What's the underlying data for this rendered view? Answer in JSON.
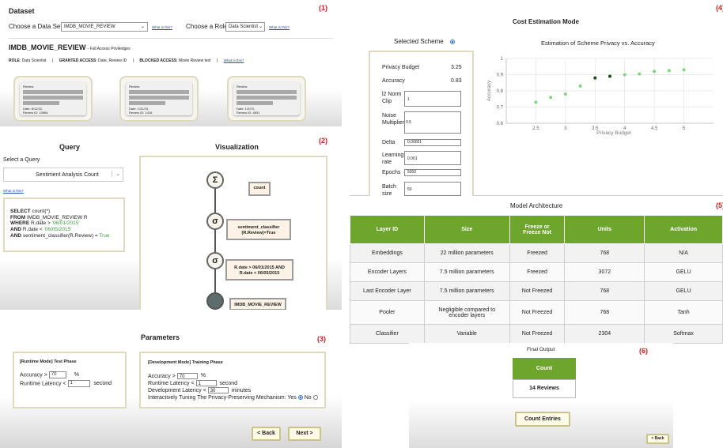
{
  "p1": {
    "tag": "(1)",
    "title": "Dataset",
    "choose_dataset": "Choose a Data Set",
    "dataset": "IMDB_MOVIE_REVIEW",
    "what1": "What is this?",
    "choose_role": "Choose a Role",
    "role": "Data Scientist",
    "what2": "What is this?",
    "dataset_name": "IMDB_MOVIE_REVIEW",
    "privileges": "- Full Access Priviledges",
    "role_label": "ROLE",
    "role_value": ": Data Scientist",
    "granted_label": "GRANTED ACCESS",
    "granted_value": ": Date, Review ID",
    "blocked_label": "BLOCKED ACCESS",
    "blocked_value": ": Movie Review text",
    "what3": "What is this?",
    "cards": [
      {
        "title": "Review:",
        "date": "Date: 8/12/22,",
        "rid": "Review ID: 10984"
      },
      {
        "title": "Review:",
        "date": "Date: 1/31/23,",
        "rid": "Review ID: 1416"
      },
      {
        "title": "Review:",
        "date": "Date: 1/2/23,",
        "rid": "Review ID: 4831"
      }
    ]
  },
  "p2": {
    "tag": "(2)",
    "query_title": "Query",
    "viz_title": "Visualization",
    "select_query": "Select a Query",
    "query": "Sentiment Analysis Count",
    "what": "What is this?",
    "sql": [
      {
        "k": "SELECT",
        "v": " count(*)"
      },
      {
        "k": "FROM",
        "v": " IMDB_MOVIE_REVIEW R"
      },
      {
        "k": "WHERE",
        "v": " R.date > ",
        "s": "'06/01/2015'"
      },
      {
        "k": "AND",
        "v": " R.date < ",
        "s": "'06/05/2015'"
      },
      {
        "k": "AND",
        "v": " sentiment_classifier(R.Review) = ",
        "s": "True"
      }
    ],
    "nodes": {
      "sigma": "Σ",
      "s1": "σ",
      "s2": "σ"
    },
    "count_box": "count",
    "classifier_box_1": "sentiment_classifier",
    "classifier_box_2": "(R.Review)=True",
    "date_box_1": "R.date > 06/01/2015 AND",
    "date_box_2": "R.date < 06/05/2015",
    "table_box": "IMDB_MOVIE_REVIEW"
  },
  "p3": {
    "tag": "(3)",
    "title": "Parameters",
    "runtime_title": "[Runtime Mode] Test Phase",
    "acc_label": "Accuracy  >",
    "acc_val": "70",
    "pct": "%",
    "rt_label": "Runtime Latency  <",
    "rt_val": "1",
    "second": "second",
    "dev_title": "[Development Mode] Training Phase",
    "dacc_label": "Accuracy  >",
    "dacc_val": "70",
    "dpct": "%",
    "drt_label": "Runtime Latency  <",
    "drt_val": "1",
    "dsecond": "second",
    "dev_label": "Development Latency  <",
    "dev_val": "30",
    "minutes": "minutes",
    "tune_label": "Interactively Tuning The Privacy-Preserving Mechanism:",
    "yes": "Yes",
    "no": "No",
    "back": "< Back",
    "next": "Next >"
  },
  "p4": {
    "tag": "(4)",
    "title": "Cost Estimation Mode",
    "selected_scheme": "Selected Scheme",
    "fields": {
      "budget_label": "Privacy Budget",
      "budget_val": "3.25",
      "acc_label": "Accuracy",
      "acc_val": "0.83",
      "l2_label_1": "l2 Norm",
      "l2_label_2": "Clip",
      "l2_val": "1",
      "noise_label_1": "Noise",
      "noise_label_2": "Multiplier",
      "noise_val": "0.5",
      "delta_label": "Delta",
      "delta_val": "0.00001",
      "lr_label_1": "Learning",
      "lr_label_2": "rate",
      "lr_val": "0.001",
      "epochs_label": "Epochs",
      "epochs_val": "5000",
      "batch_label_1": "Batch",
      "batch_label_2": "size",
      "batch_val": "50"
    }
  },
  "chart_data": {
    "type": "scatter",
    "title": "Estimation of Scheme Privacy vs. Accuracy",
    "xlabel": "Privacy Budget",
    "ylabel": "Accuracy",
    "xlim": [
      2,
      5.5
    ],
    "ylim": [
      0.6,
      1.0
    ],
    "xticks": [
      "2.5",
      "3",
      "3.5",
      "4",
      "4.5",
      "5"
    ],
    "yticks": [
      "0.6",
      "0.7",
      "0.8",
      "0.9",
      "1"
    ],
    "grid": true,
    "x": [
      2.5,
      2.75,
      3.0,
      3.25,
      3.5,
      3.75,
      4.0,
      4.25,
      4.5,
      4.75,
      5.0
    ],
    "y": [
      0.73,
      0.76,
      0.78,
      0.83,
      0.88,
      0.89,
      0.9,
      0.905,
      0.92,
      0.925,
      0.93
    ],
    "highlight": [
      3.5,
      3.75
    ],
    "point_color": "#7fd67f",
    "highlight_color": "#1c4a1c"
  },
  "p5": {
    "tag": "(5)",
    "title": "Model Architecture",
    "headers": [
      "Layer ID",
      "Size",
      "Freeze or\nFreeze Not",
      "Units",
      "Activation"
    ],
    "rows": [
      [
        "Embeddings",
        "22 million parameters",
        "Freezed",
        "768",
        "N/A"
      ],
      [
        "Encoder Layers",
        "7.5 million parameters",
        "Freezed",
        "3072",
        "GELU"
      ],
      [
        "Last Encoder Layer",
        "7.5 million parameters",
        "Not Freezed",
        "768",
        "GELU"
      ],
      [
        "Pooler",
        "Negligible compared to encoder layers",
        "Not Freezed",
        "768",
        "Tanh"
      ],
      [
        "Classifier",
        "Variable",
        "Not Freezed",
        "2304",
        "Softmax"
      ]
    ]
  },
  "p6": {
    "tag": "(6)",
    "title": "Final Output",
    "count_header": "Count",
    "count_value": "14 Reviews",
    "count_entries": "Count Entries",
    "back": "< Back"
  },
  "colors": {
    "accent_green": "#6ea52c",
    "tag_red": "#d21f1f",
    "radio_blue": "#2c7be5"
  }
}
